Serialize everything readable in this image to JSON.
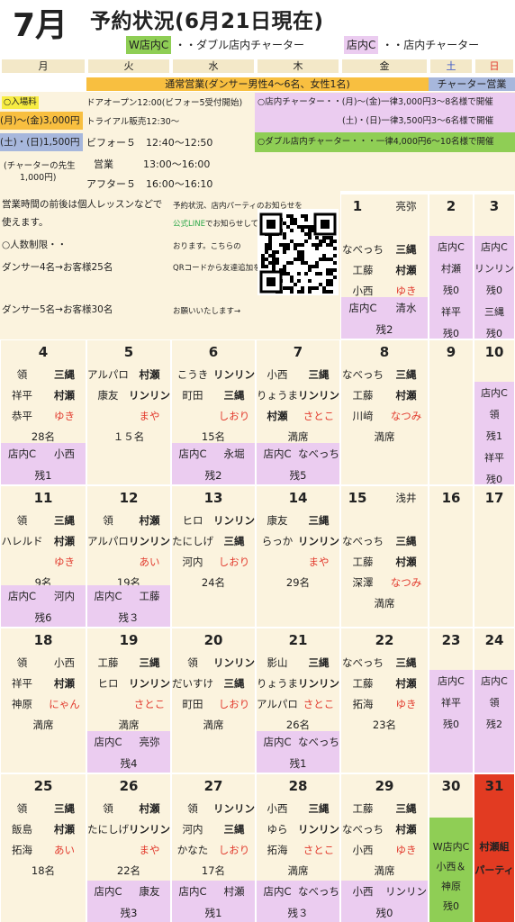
{
  "header": {
    "month": "7月",
    "title": "予約状況(6月21日現在)",
    "legend_w": "W店内C",
    "legend_w_text": "・・ダブル店内チャーター",
    "legend_c": "店内C",
    "legend_c_text": "・・店内チャーター"
  },
  "weekdays": [
    "月",
    "火",
    "水",
    "木",
    "金",
    "土",
    "日"
  ],
  "info": {
    "normal": "通常営業(ダンサー男性4～6名、女性1名)",
    "charter": "チャーター営業",
    "entry": "○入場料",
    "weekday_fee": "(月)～(金)3,000円",
    "weekend_fee": "(土)・(日)1,500円",
    "charter_note": "(チャーターの先生",
    "charter_note2": "1,000円)",
    "door": "ドアオープン12:00(ビフォー5受付開始)",
    "trial": "トライアル販売12:30～",
    "before": "ビフォー５　12:40～12:50",
    "open": "営業　　　13:00～16:00",
    "after": "アフター５　16:00～16:10",
    "c1": "○店内チャーター・・(月)～(金)一律3,000円3～8名様で開催",
    "c2": "(土)・(日)一律3,500円3～6名様で開催",
    "c3": "○ダブル店内チャーター・・・一律4,000円6～10名様で開催",
    "lesson1": "営業時間の前後は個人レッスンなどで",
    "lesson2": "使えます。",
    "limit": "○人数制限・・",
    "limit1": "ダンサー4名→お客様25名",
    "limit2": "ダンサー5名→お客様30名",
    "line1": "予約状況、店内パーティのお知らせを",
    "line2a": "公式LINE",
    "line2b": "でお知らせして",
    "line3": "おります。こちらの",
    "line4": "QRコードから友達追加を",
    "line5": "お願いいたします→"
  }
}
